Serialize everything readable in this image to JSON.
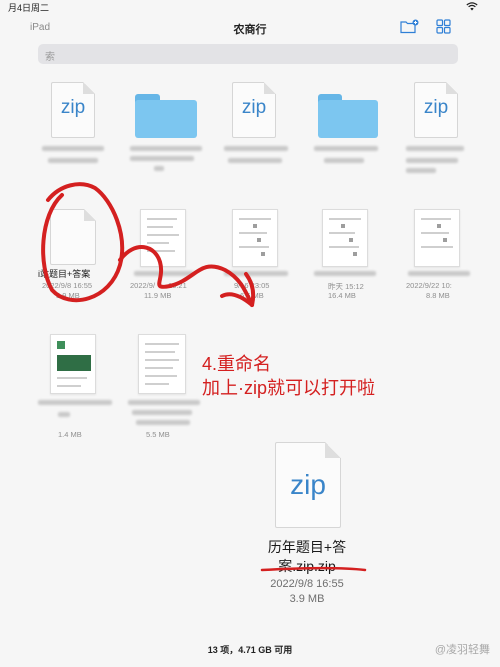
{
  "status": {
    "time": "月4日周二"
  },
  "nav": {
    "back": "iPad",
    "title": "农商行"
  },
  "search": {
    "text": "索"
  },
  "files": {
    "zip1": "zip",
    "zip2": "zip",
    "zip3": "zip",
    "zip_big": "zip",
    "doc1_name": "i站题目+答案",
    "doc1_date": "2022/9/8 16:55",
    "doc1_size": "3.9 MB",
    "doc2_date": "2022/9/",
    "doc2_time": "15:21",
    "doc2_size": "11.9 MB",
    "doc3_date": "9/16 23:05",
    "doc3_size": "6.6 MB",
    "doc4_date": "昨天 15:12",
    "doc4_size": "16.4 MB",
    "doc5_date": "2022/9/22 10:",
    "doc5_size": "8.8 MB",
    "doc6_size": "1.4 MB",
    "doc7_size": "5.5 MB"
  },
  "annotation": {
    "step": "4.重命名",
    "instruction": "加上·zip就可以打开啦"
  },
  "big_file": {
    "name_line1": "历年题目+答",
    "name_line2": "案.zip.zip",
    "date": "2022/9/8 16:55",
    "size": "3.9 MB"
  },
  "footer": {
    "summary": "13 项，4.71 GB 可用"
  },
  "watermark": "@凌羽轻舞",
  "colors": {
    "annotation": "#d42020",
    "zip_text": "#3a85c9",
    "folder": "#7cc6f0"
  }
}
